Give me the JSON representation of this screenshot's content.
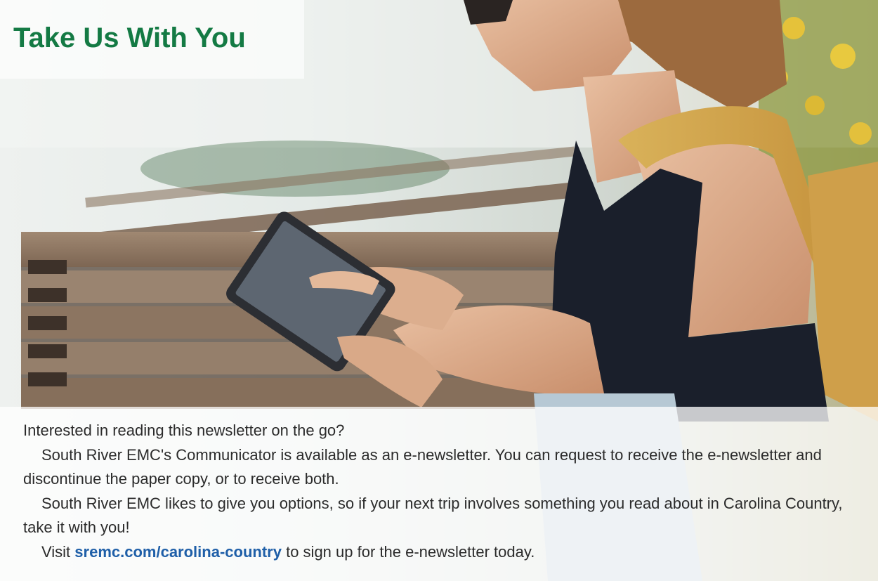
{
  "title": "Take Us With You",
  "paragraphs": {
    "p1": "Interested in reading this newsletter on the go?",
    "p2": "South River EMC's Communicator is available as an e-newsletter. You can request to receive the e-newsletter and discontinue the paper copy, or to receive both.",
    "p3": "South River EMC likes to give you options, so if your next trip involves something you read about in Carolina Country, take it with you!",
    "p4_before": "Visit",
    "p4_link": "sremc.com/carolina-country",
    "p4_after": "to sign up for the e-newsletter today."
  },
  "colors": {
    "title": "#147a44",
    "link": "#1f5fa8",
    "body_text": "#2b2b2b"
  }
}
